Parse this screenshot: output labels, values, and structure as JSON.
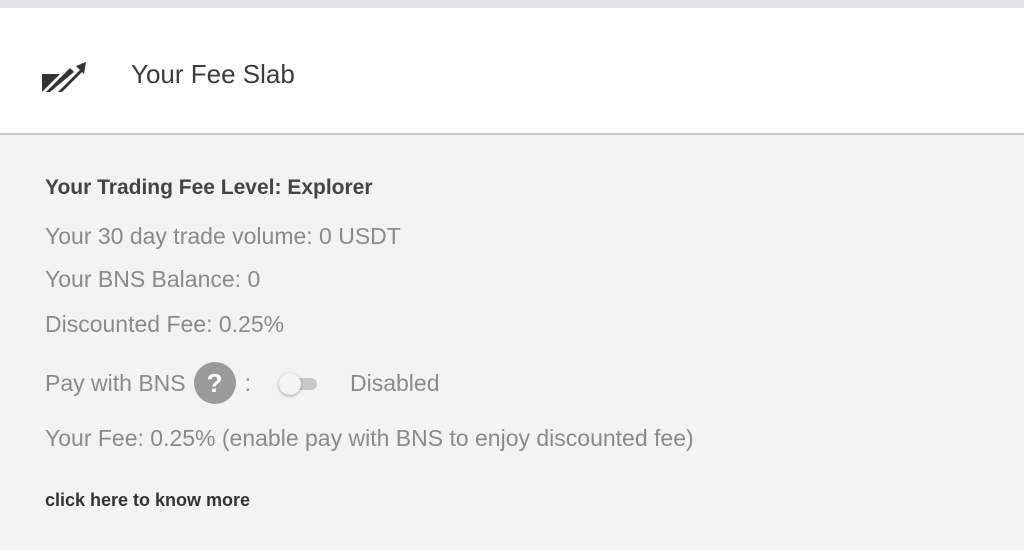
{
  "header": {
    "logo_icon": "brand-logo-icon",
    "title": "Your Fee Slab"
  },
  "fee_info": {
    "level": "Your Trading Fee Level: Explorer",
    "volume": "Your 30 day trade volume: 0 USDT",
    "balance": "Your BNS Balance: 0",
    "discounted_fee": "Discounted Fee: 0.25%",
    "pay_label": "Pay with BNS",
    "help_icon": "?",
    "colon": ":",
    "toggle_on": false,
    "toggle_state": "Disabled",
    "your_fee": "Your Fee: 0.25% (enable pay with BNS to enjoy discounted fee)",
    "know_more": "click here to know more"
  },
  "colors": {
    "header_bg": "#ffffff",
    "panel_bg": "#f3f3f3",
    "text_muted": "#8a8a8a",
    "text_dark": "#444444",
    "help_icon_bg": "#9a9a9a"
  }
}
